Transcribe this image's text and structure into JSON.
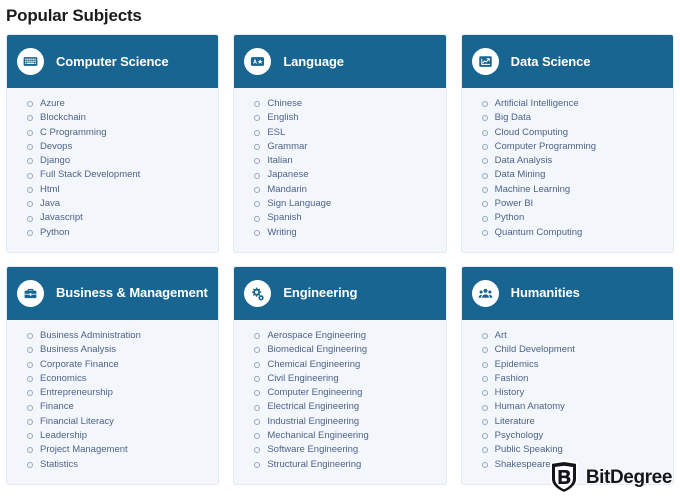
{
  "page": {
    "title": "Popular Subjects"
  },
  "cards": [
    {
      "title": "Computer Science",
      "icon": "keyboard-icon",
      "items": [
        "Azure",
        "Blockchain",
        "C Programming",
        "Devops",
        "Django",
        "Full Stack Development",
        "Html",
        "Java",
        "Javascript",
        "Python"
      ]
    },
    {
      "title": "Language",
      "icon": "translate-icon",
      "items": [
        "Chinese",
        "English",
        "ESL",
        "Grammar",
        "Italian",
        "Japanese",
        "Mandarin",
        "Sign Language",
        "Spanish",
        "Writing"
      ]
    },
    {
      "title": "Data Science",
      "icon": "chart-line-icon",
      "items": [
        "Artificial Intelligence",
        "Big Data",
        "Cloud Computing",
        "Computer Programming",
        "Data Analysis",
        "Data Mining",
        "Machine Learning",
        "Power BI",
        "Python",
        "Quantum Computing"
      ]
    },
    {
      "title": "Business & Management",
      "icon": "briefcase-icon",
      "items": [
        "Business Administration",
        "Business Analysis",
        "Corporate Finance",
        "Economics",
        "Entrepreneurship",
        "Finance",
        "Financial Literacy",
        "Leadership",
        "Project Management",
        "Statistics"
      ]
    },
    {
      "title": "Engineering",
      "icon": "gears-icon",
      "items": [
        "Aerospace Engineering",
        "Biomedical Engineering",
        "Chemical Engineering",
        "Civil Engineering",
        "Computer Engineering",
        "Electrical Engineering",
        "Industrial Engineering",
        "Mechanical Engineering",
        "Software Engineering",
        "Structural Engineering"
      ]
    },
    {
      "title": "Humanities",
      "icon": "people-group-icon",
      "items": [
        "Art",
        "Child Development",
        "Epidemics",
        "Fashion",
        "History",
        "Human Anatomy",
        "Literature",
        "Psychology",
        "Public Speaking",
        "Shakespeare"
      ]
    }
  ],
  "watermark": {
    "brand": "BitDegree",
    "icon": "bitdegree-shield-logo"
  },
  "colors": {
    "header_blue": "#186591",
    "card_body": "#f3f7fc",
    "card_border": "#e2eaf4",
    "item_text": "#4d6387",
    "title_text": "#1b1b1b",
    "bullet": "#93a7c2"
  }
}
